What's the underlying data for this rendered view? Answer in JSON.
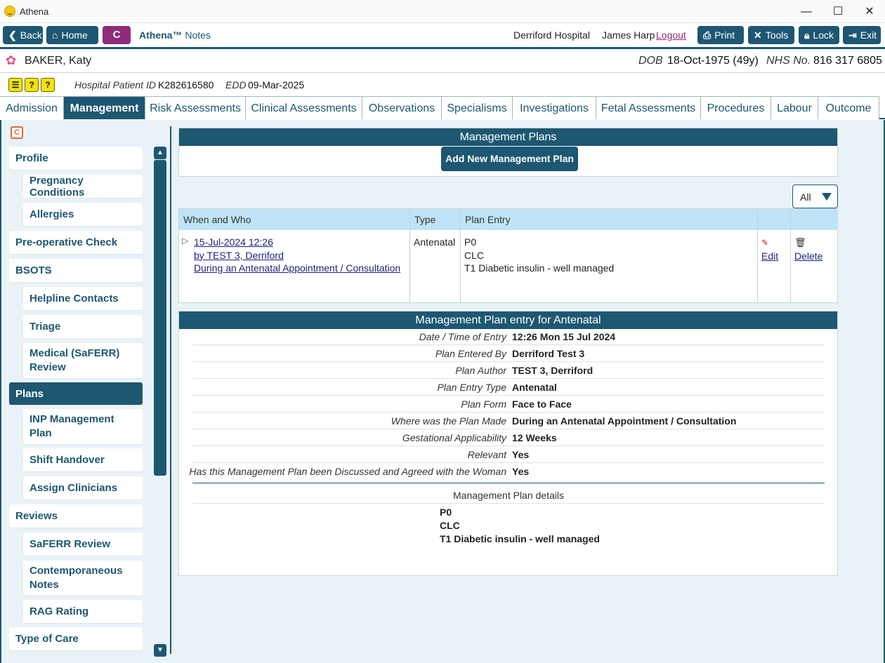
{
  "window": {
    "title": "Athena",
    "minimize": "—",
    "maximize": "☐",
    "close": "✕"
  },
  "toolbar": {
    "back": "Back",
    "home": "Home",
    "c_button": "C",
    "app_name_bold": "Athena™",
    "app_name_rest": " Notes",
    "hospital": "Derriford Hospital",
    "user": "James Harp",
    "logout": "Logout",
    "print": "Print",
    "tools": "Tools",
    "lock": "Lock",
    "exit": "Exit"
  },
  "patient": {
    "name": "BAKER, Katy",
    "dob_label": "DOB",
    "dob": "18-Oct-1975 (49y)",
    "nhs_label": "NHS No.",
    "nhs": "816 317 6805",
    "hospital_id_label": "Hospital Patient ID",
    "hospital_id": "K282616580",
    "edd_label": "EDD",
    "edd": "09-Mar-2025"
  },
  "tabs": [
    "Admission",
    "Management",
    "Risk Assessments",
    "Clinical Assessments",
    "Observations",
    "Specialisms",
    "Investigations",
    "Fetal Assessments",
    "Procedures",
    "Labour",
    "Outcome"
  ],
  "sidebar": {
    "items": [
      "Profile",
      "Pregnancy Conditions",
      "Allergies",
      "Pre-operative Check",
      "BSOTS",
      "Helpline Contacts",
      "Triage",
      "Medical (SaFERR) Review",
      "Plans",
      "INP Management Plan",
      "Shift Handover",
      "Assign Clinicians",
      "Reviews",
      "SaFERR Review",
      "Contemporaneous Notes",
      "RAG Rating",
      "Type of Care"
    ],
    "c_badge": "C"
  },
  "plans": {
    "title": "Management Plans",
    "add_button": "Add New Management Plan",
    "filter": "All",
    "columns": [
      "When and Who",
      "Type",
      "Plan Entry"
    ],
    "row": {
      "date": "15-Jul-2024 12:26",
      "by": "by TEST 3, Derriford",
      "context": "During an Antenatal Appointment / Consultation",
      "type": "Antenatal",
      "entry": [
        "P0",
        "CLC",
        "T1 Diabetic insulin - well managed"
      ],
      "edit": "Edit",
      "delete": "Delete"
    }
  },
  "detail": {
    "title": "Management Plan entry for Antenatal",
    "rows": [
      {
        "label": "Date / Time of Entry",
        "value": "12:26 Mon 15 Jul 2024"
      },
      {
        "label": "Plan Entered By",
        "value": "Derriford Test 3"
      },
      {
        "label": "Plan Author",
        "value": "TEST 3, Derriford"
      },
      {
        "label": "Plan Entry Type",
        "value": "Antenatal"
      },
      {
        "label": "Plan Form",
        "value": "Face to Face"
      },
      {
        "label": "Where was the Plan Made",
        "value": "During an Antenatal Appointment / Consultation"
      },
      {
        "label": "Gestational Applicability",
        "value": "12 Weeks"
      },
      {
        "label": "Relevant",
        "value": "Yes"
      },
      {
        "label": "Has this Management Plan been Discussed and Agreed with the Woman",
        "value": "Yes"
      }
    ],
    "details_heading": "Management Plan details",
    "details": [
      "P0",
      "CLC",
      "T1 Diabetic insulin - well managed"
    ]
  },
  "icons": {
    "app": "smiley-icon",
    "back": "chevron-left-icon",
    "home": "home-icon",
    "print": "printer-icon",
    "tools": "tools-icon",
    "lock": "lock-icon",
    "exit": "exit-icon",
    "patient": "flower-icon",
    "expand": "triangle-right-icon",
    "edit": "pencil-icon",
    "delete": "trash-icon"
  },
  "colors": {
    "primary": "#1d5772",
    "accent": "#8e2c7b",
    "header_cell": "#bfe4f7",
    "background": "#e9f3f7",
    "alert": "#f3e400"
  }
}
